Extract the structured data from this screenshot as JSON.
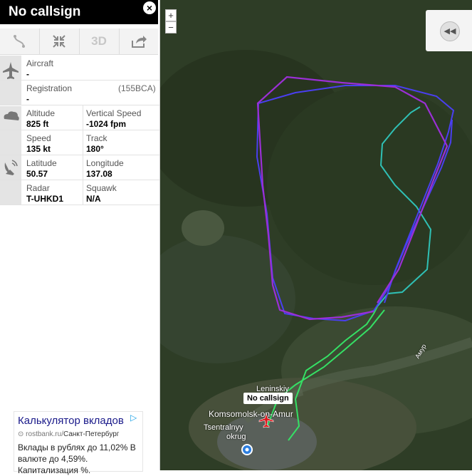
{
  "header": {
    "callsign": "No callsign",
    "close_glyph": "×"
  },
  "toolbar": {
    "route_icon": "route-icon",
    "collapse_icon": "collapse-icon",
    "three_d_label": "3D",
    "share_icon": "share-icon"
  },
  "details": {
    "aircraft_label": "Aircraft",
    "aircraft_value": "-",
    "registration_label": "Registration",
    "registration_value": "-",
    "registration_code": "(155BCA)",
    "altitude_label": "Altitude",
    "altitude_value": "825 ft",
    "vspeed_label": "Vertical Speed",
    "vspeed_value": "-1024 fpm",
    "speed_label": "Speed",
    "speed_value": "135 kt",
    "track_label": "Track",
    "track_value": "180°",
    "latitude_label": "Latitude",
    "latitude_value": "50.57",
    "longitude_label": "Longitude",
    "longitude_value": "137.08",
    "radar_label": "Radar",
    "radar_value": "T-UHKD1",
    "squawk_label": "Squawk",
    "squawk_value": "N/A"
  },
  "ad": {
    "title": "Калькулятор вкладов",
    "url": "rostbank.ru/",
    "url_city": "Санкт-Петербург",
    "body": "Вклады в рублях до 11,02% В валюте до 4,59%.",
    "body_more": "Капитализация %."
  },
  "map": {
    "zoom_in": "+",
    "zoom_out": "−",
    "flight_label": "No callsign",
    "labels": {
      "leninskiy": "Leninskiy",
      "city": "Komsomolsk-on-Amur",
      "district1": "Tsentralnyy",
      "district2": "okrug",
      "river": "Амур"
    },
    "playback_glyph": "◀◀"
  },
  "colors": {
    "track_purple": "#9b2fd6",
    "track_blue": "#4a3ff0",
    "track_teal": "#2fc0b5",
    "track_green": "#35e065"
  }
}
